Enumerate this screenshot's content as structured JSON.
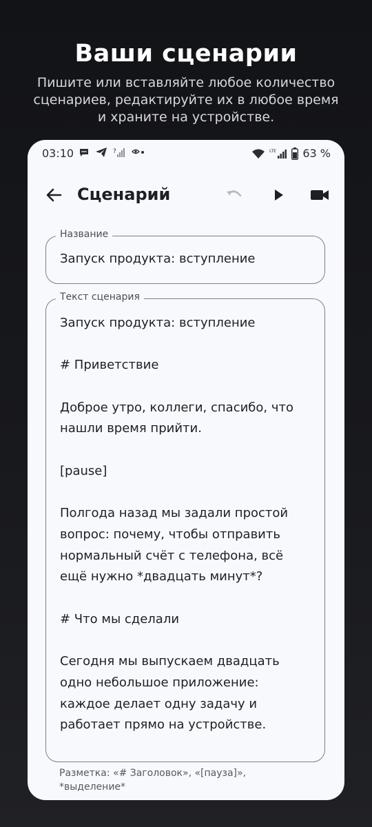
{
  "promo": {
    "title": "Ваши сценарии",
    "subtitle": "Пишите или вставляйте любое количество сценариев, редактируйте их в любое время и храните на устройстве."
  },
  "status_bar": {
    "time": "03:10",
    "battery": "63 %",
    "left_icons": [
      "chat-bubble-icon",
      "telegram-icon",
      "signal-no-data-icon",
      "app-notify-icon"
    ],
    "right_icons": [
      "wifi-icon",
      "lte-signal-icon",
      "battery-icon"
    ]
  },
  "app_bar": {
    "title": "Сценарий",
    "actions": [
      "undo-icon",
      "play-icon",
      "videocam-icon"
    ]
  },
  "form": {
    "name_label": "Название",
    "name_value": "Запуск продукта: вступление",
    "script_label": "Текст сценария",
    "script_lines": [
      "Запуск продукта: вступление",
      "",
      "# Приветствие",
      "",
      "Доброе утро, коллеги, спасибо, что",
      "нашли время прийти.",
      "",
      "[pause]",
      "",
      "Полгода назад мы задали простой",
      "вопрос: почему, чтобы отправить",
      "нормальный счёт с телефона, всё",
      "ещё нужно *двадцать минут*?",
      "",
      "# Что мы сделали",
      "",
      "Сегодня мы выпускаем двадцать",
      "одно небольшое приложение:",
      "каждое делает одну задачу и",
      "работает прямо на устройстве."
    ],
    "hint": "Разметка: «# Заголовок», «[пауза]», *выделение*"
  },
  "colors": {
    "background": "#16171b",
    "surface": "#f7f9fc",
    "text": "#1d1f23",
    "outline": "#7c7f86",
    "disabled": "#b5b8be"
  }
}
